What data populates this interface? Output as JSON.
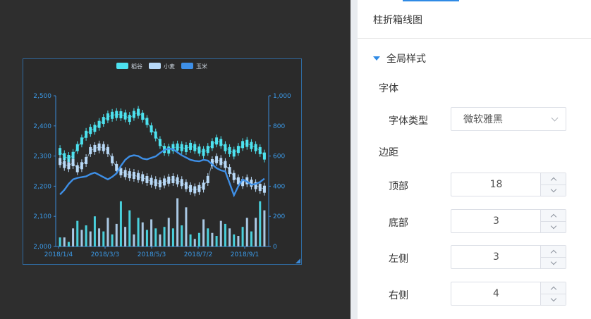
{
  "panel": {
    "title": "柱折箱线图",
    "section": "全局样式",
    "font_group": "字体",
    "font_type_label": "字体类型",
    "font_type_value": "微软雅黑",
    "margin_group": "边距",
    "margins": [
      {
        "label": "顶部",
        "value": "18"
      },
      {
        "label": "底部",
        "value": "3"
      },
      {
        "label": "左侧",
        "value": "3"
      },
      {
        "label": "右侧",
        "value": "4"
      }
    ]
  },
  "colors": {
    "accent": "#2f8ae5",
    "rice": "#4de2ef",
    "wheat": "#b8d9f7",
    "corn": "#3e8fe6",
    "axis": "#3b8ad8"
  },
  "chart_data": {
    "type": "bar+line+boxplot",
    "legend": [
      "稻谷",
      "小麦",
      "玉米"
    ],
    "x_ticks": [
      "2018/1/4",
      "2018/3/3",
      "2018/5/3",
      "2018/7/2",
      "2018/9/1"
    ],
    "y_left": {
      "ticks": [
        "2,000",
        "2,100",
        "2,200",
        "2,300",
        "2,400",
        "2,500"
      ],
      "range": [
        2000,
        2500
      ]
    },
    "y_right": {
      "ticks": [
        "0",
        "200",
        "400",
        "600",
        "800",
        "1,000"
      ],
      "range": [
        0,
        1000
      ]
    },
    "series": [
      {
        "name": "稻谷",
        "type": "boxplot",
        "values": [
          2315,
          2298,
          2292,
          2302,
          2328,
          2350,
          2372,
          2385,
          2392,
          2405,
          2418,
          2430,
          2435,
          2438,
          2437,
          2433,
          2425,
          2438,
          2445,
          2432,
          2415,
          2390,
          2370,
          2345,
          2322,
          2320,
          2328,
          2330,
          2328,
          2325,
          2332,
          2328,
          2320,
          2312,
          2322,
          2338,
          2350,
          2345,
          2328,
          2318,
          2310,
          2322,
          2338,
          2342,
          2335,
          2328,
          2318,
          2300
        ]
      },
      {
        "name": "小麦",
        "type": "boxplot",
        "values": [
          2282,
          2272,
          2268,
          2278,
          2258,
          2268,
          2285,
          2318,
          2325,
          2330,
          2328,
          2318,
          2288,
          2262,
          2248,
          2242,
          2238,
          2236,
          2232,
          2228,
          2222,
          2216,
          2212,
          2208,
          2214,
          2220,
          2222,
          2218,
          2212,
          2202,
          2192,
          2188,
          2192,
          2200,
          2222,
          2278,
          2288,
          2282,
          2272,
          2252,
          2232,
          2218,
          2212,
          2218,
          2210,
          2202,
          2196,
          2190
        ]
      },
      {
        "name": "玉米",
        "type": "line",
        "values": [
          345,
          375,
          415,
          445,
          455,
          460,
          465,
          480,
          490,
          475,
          460,
          445,
          462,
          485,
          535,
          575,
          598,
          605,
          600,
          583,
          578,
          588,
          598,
          620,
          640,
          650,
          645,
          625,
          605,
          590,
          575,
          568,
          565,
          575,
          570,
          545,
          520,
          505,
          498,
          420,
          340,
          400,
          445,
          430,
          410,
          415,
          428,
          450
        ]
      },
      {
        "name": "bars",
        "type": "bar",
        "values": [
          60,
          60,
          30,
          120,
          170,
          110,
          140,
          100,
          200,
          120,
          100,
          190,
          80,
          150,
          300,
          130,
          240,
          80,
          190,
          160,
          110,
          180,
          120,
          80,
          130,
          190,
          120,
          320,
          140,
          260,
          80,
          50,
          90,
          180,
          120,
          90,
          70,
          170,
          150,
          120,
          80,
          70,
          130,
          190,
          100,
          190,
          300,
          240
        ]
      }
    ]
  }
}
